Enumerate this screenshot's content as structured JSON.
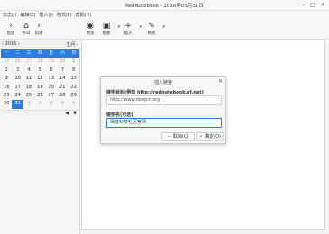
{
  "window": {
    "title": "RedNotebook - 2016年05月31日"
  },
  "window_controls": [
    "–",
    "□",
    "✕"
  ],
  "menu": [
    "日志(J)",
    "编辑(E)",
    "插入(I)",
    "格式(F)",
    "帮助(H)"
  ],
  "toolbar": {
    "back": "后退",
    "today": "今日",
    "forward": "前进",
    "preview": "预览",
    "template": "模板",
    "insert": "插入",
    "format": "格式"
  },
  "calendar": {
    "year_label": "‹ 2016 ›",
    "month_label": "五月 ›",
    "weekdays": [
      "一",
      "二",
      "三",
      "四",
      "五",
      "六",
      "日"
    ],
    "weeks": [
      [
        "25",
        "26",
        "27",
        "28",
        "29",
        "30",
        "1"
      ],
      [
        "2",
        "3",
        "4",
        "5",
        "6",
        "7",
        "8"
      ],
      [
        "9",
        "10",
        "11",
        "12",
        "13",
        "14",
        "15"
      ],
      [
        "16",
        "17",
        "18",
        "19",
        "20",
        "21",
        "22"
      ],
      [
        "23",
        "24",
        "25",
        "26",
        "27",
        "28",
        "29"
      ],
      [
        "30",
        "31",
        "1",
        "2",
        "3",
        "4",
        "5"
      ]
    ],
    "selected_day": "31"
  },
  "tags_bar": {
    "left": "◀",
    "right": "▼"
  },
  "dialog": {
    "title": "插入链接",
    "close": "✕",
    "url_label": "链接目标(例如 http://rednotebook.sf.net)",
    "url_value": "http://www.deepin.org",
    "name_label": "链接名(可选)",
    "name_value": "深度科技社区官网",
    "cancel_label": "取消(C)",
    "ok_label": "确定(O)"
  }
}
